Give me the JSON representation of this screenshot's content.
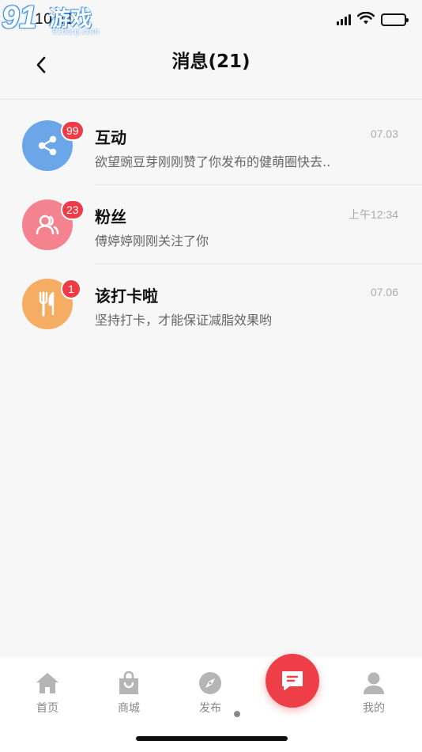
{
  "status_bar": {
    "time": "10:41",
    "watermark_logo": "91",
    "watermark_text": "游戏",
    "watermark_url": "91danji.com"
  },
  "header": {
    "title": "消息(21)"
  },
  "messages": [
    {
      "title": "互动",
      "preview": "欲望豌豆芽刚刚赞了你发布的健萌圈快去..",
      "time": "07.03",
      "badge": "99",
      "icon": "share-icon",
      "color": "#6aa6e8"
    },
    {
      "title": "粉丝",
      "preview": "傅婷婷刚刚关注了你",
      "time": "上午12:34",
      "badge": "23",
      "icon": "users-icon",
      "color": "#f4828f"
    },
    {
      "title": "该打卡啦",
      "preview": "坚持打卡，才能保证减脂效果哟",
      "time": "07.06",
      "badge": "1",
      "icon": "cutlery-icon",
      "color": "#f5ad63"
    }
  ],
  "tabs": [
    {
      "label": "首页",
      "icon": "home-icon"
    },
    {
      "label": "商城",
      "icon": "shopping-bag-icon"
    },
    {
      "label": "发布",
      "icon": "compass-icon"
    },
    {
      "label": "消息",
      "icon": "message-icon"
    },
    {
      "label": "我的",
      "icon": "profile-icon"
    }
  ],
  "colors": {
    "accent": "#ee3f48",
    "badge": "#ef3b46"
  }
}
